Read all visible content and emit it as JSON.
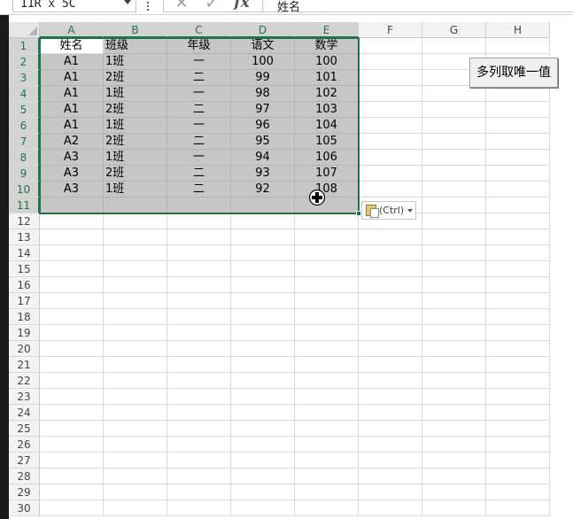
{
  "name_box": {
    "value": "11R x 5C"
  },
  "formula_bar": {
    "content": "姓名",
    "fx_label": "fx"
  },
  "columns": [
    "A",
    "B",
    "C",
    "D",
    "E",
    "F",
    "G",
    "H"
  ],
  "rows": [
    "1",
    "2",
    "3",
    "4",
    "5",
    "6",
    "7",
    "8",
    "9",
    "10",
    "11",
    "12",
    "13",
    "14",
    "15",
    "16",
    "17",
    "18",
    "19",
    "20",
    "21",
    "22",
    "23",
    "24",
    "25",
    "26",
    "27",
    "28",
    "29",
    "30"
  ],
  "table": [
    [
      "姓名",
      "班级",
      "年级",
      "语文",
      "数学"
    ],
    [
      "A1",
      "1班",
      "一",
      "100",
      "100"
    ],
    [
      "A1",
      "2班",
      "二",
      "99",
      "101"
    ],
    [
      "A1",
      "1班",
      "一",
      "98",
      "102"
    ],
    [
      "A1",
      "2班",
      "二",
      "97",
      "103"
    ],
    [
      "A1",
      "1班",
      "一",
      "96",
      "104"
    ],
    [
      "A2",
      "2班",
      "二",
      "95",
      "105"
    ],
    [
      "A3",
      "1班",
      "一",
      "94",
      "106"
    ],
    [
      "A3",
      "2班",
      "二",
      "93",
      "107"
    ],
    [
      "A3",
      "1班",
      "二",
      "92",
      "108"
    ],
    [
      "",
      "",
      "",
      "",
      ""
    ]
  ],
  "paste_options": {
    "label": "(Ctrl)"
  },
  "macro_button": {
    "label": "多列取唯一值"
  },
  "colors": {
    "accent": "#217346",
    "selection_fill": "#c6c6c6"
  }
}
